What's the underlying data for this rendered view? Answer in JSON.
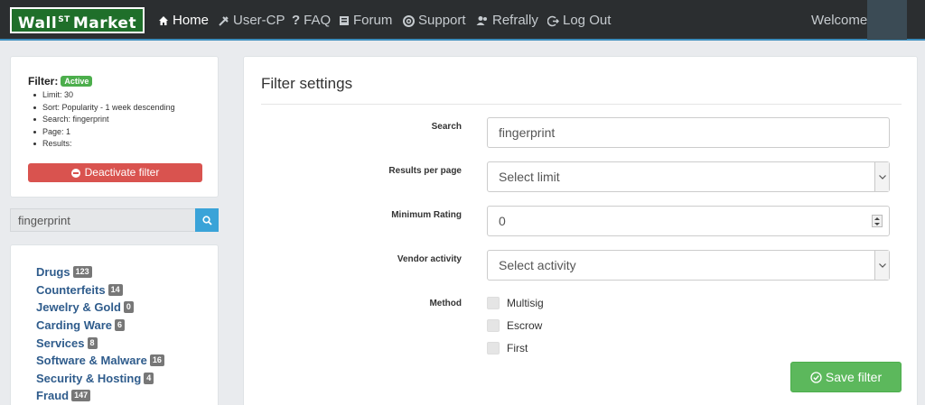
{
  "nav": {
    "logo_main": "Wall",
    "logo_sup": "ST",
    "logo_end": "Market",
    "items": [
      {
        "label": "Home",
        "icon": "home-icon"
      },
      {
        "label": "User-CP",
        "icon": "tools-icon"
      },
      {
        "label": "FAQ",
        "icon": "question-icon"
      },
      {
        "label": "Forum",
        "icon": "forum-icon"
      },
      {
        "label": "Support",
        "icon": "lifebuoy-icon"
      },
      {
        "label": "Refrally",
        "icon": "users-icon"
      },
      {
        "label": "Log Out",
        "icon": "logout-icon"
      }
    ],
    "welcome": "Welcome,"
  },
  "filter": {
    "title": "Filter:",
    "status": "Active",
    "items": [
      "Limit: 30",
      "Sort: Popularity - 1 week descending",
      "Search: fingerprint",
      "Page: 1",
      "Results:"
    ],
    "deactivate_label": "Deactivate filter"
  },
  "search": {
    "value": "fingerprint"
  },
  "categories": [
    {
      "name": "Drugs",
      "count": "123"
    },
    {
      "name": "Counterfeits",
      "count": "14"
    },
    {
      "name": "Jewelry & Gold",
      "count": "0"
    },
    {
      "name": "Carding Ware",
      "count": "6"
    },
    {
      "name": "Services",
      "count": "8"
    },
    {
      "name": "Software & Malware",
      "count": "16"
    },
    {
      "name": "Security & Hosting",
      "count": "4"
    },
    {
      "name": "Fraud",
      "count": "147"
    }
  ],
  "settings": {
    "title": "Filter settings",
    "search_label": "Search",
    "search_value": "fingerprint",
    "results_label": "Results per page",
    "results_value": "Select limit",
    "rating_label": "Minimum Rating",
    "rating_value": "0",
    "vendor_label": "Vendor activity",
    "vendor_value": "Select activity",
    "method_label": "Method",
    "methods": [
      "Multisig",
      "Escrow",
      "First"
    ],
    "save_label": "Save filter"
  },
  "colors": {
    "navbar": "#2b2e30",
    "logo_bg": "#1f6f2a",
    "danger": "#d9534f",
    "success": "#5cb85c",
    "link": "#2f5c8c",
    "search_btn": "#3aa3d8"
  }
}
